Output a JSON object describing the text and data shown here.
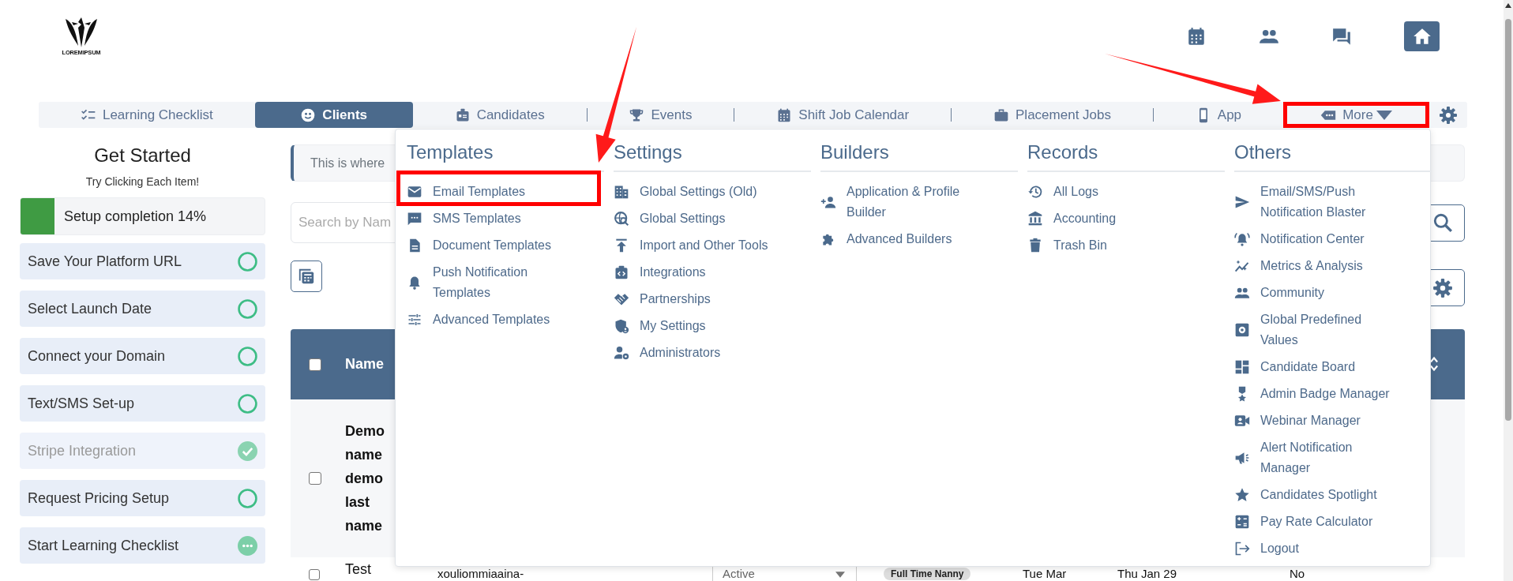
{
  "logo": {
    "text": "LOREMIPSUM"
  },
  "nav": {
    "tabs": [
      {
        "label": "Learning Checklist",
        "selected": false
      },
      {
        "label": "Clients",
        "selected": true
      },
      {
        "label": "Candidates",
        "selected": false
      },
      {
        "label": "Events",
        "selected": false
      },
      {
        "label": "Shift Job Calendar",
        "selected": false
      },
      {
        "label": "Placement Jobs",
        "selected": false
      },
      {
        "label": "App",
        "selected": false
      },
      {
        "label": "More",
        "selected": false,
        "kind": "dropdown",
        "annotated": true
      }
    ]
  },
  "sidebar": {
    "title": "Get Started",
    "subtitle": "Try Clicking Each Item!",
    "progress": {
      "label": "Setup completion 14%",
      "level": 0.14
    },
    "items": [
      {
        "label": "Save Your Platform URL",
        "kind": "todo"
      },
      {
        "label": "Select Launch Date",
        "kind": "todo"
      },
      {
        "label": "Connect your Domain",
        "kind": "todo"
      },
      {
        "label": "Text/SMS Set-up",
        "kind": "todo"
      },
      {
        "label": "Stripe Integration",
        "kind": "done"
      },
      {
        "label": "Request Pricing Setup",
        "kind": "todo"
      },
      {
        "label": "Start Learning Checklist",
        "kind": "started"
      }
    ]
  },
  "main": {
    "banner": "This is where",
    "search": {
      "placeholder": "Search by Nam"
    },
    "table": {
      "header": {
        "checked": false,
        "columns": [
          "Name"
        ]
      },
      "rows": [
        {
          "checked": false,
          "emphasized": true,
          "name": "Demo name demo last name"
        },
        {
          "checked": false,
          "emphasized": false,
          "name": "Test",
          "column_3": "xouliommiaaina-",
          "status": "Active",
          "tag": "Full Time Nanny",
          "column_6": "Tue Mar",
          "column_7": "Thu Jan 29",
          "column_8": "No"
        }
      ]
    }
  },
  "menu": {
    "columns": [
      {
        "title": "Templates",
        "items": [
          {
            "label": "Email Templates",
            "annotated": true
          },
          {
            "label": "SMS Templates",
            "annotated": false
          },
          {
            "label": "Document Templates",
            "annotated": false
          },
          {
            "label": "Push Notification Templates",
            "annotated": false
          },
          {
            "label": "Advanced Templates",
            "annotated": false
          }
        ]
      },
      {
        "title": "Settings",
        "items": [
          {
            "label": "Global Settings (Old)",
            "annotated": false
          },
          {
            "label": "Global Settings",
            "annotated": false
          },
          {
            "label": "Import and Other Tools",
            "annotated": false
          },
          {
            "label": "Integrations",
            "annotated": false
          },
          {
            "label": "Partnerships",
            "annotated": false
          },
          {
            "label": "My Settings",
            "annotated": false
          },
          {
            "label": "Administrators",
            "annotated": false
          }
        ]
      },
      {
        "title": "Builders",
        "items": [
          {
            "label": "Application & Profile Builder",
            "annotated": false
          },
          {
            "label": "Advanced Builders",
            "annotated": false
          }
        ]
      },
      {
        "title": "Records",
        "items": [
          {
            "label": "All Logs",
            "annotated": false
          },
          {
            "label": "Accounting",
            "annotated": false
          },
          {
            "label": "Trash Bin",
            "annotated": false
          }
        ]
      },
      {
        "title": "Others",
        "items": [
          {
            "label": "Email/SMS/Push Notification Blaster",
            "annotated": false
          },
          {
            "label": "Notification Center",
            "annotated": false
          },
          {
            "label": "Metrics & Analysis",
            "annotated": false
          },
          {
            "label": "Community",
            "annotated": false
          },
          {
            "label": "Global Predefined Values",
            "annotated": false
          },
          {
            "label": "Candidate Board",
            "annotated": false
          },
          {
            "label": "Admin Badge Manager",
            "annotated": false
          },
          {
            "label": "Webinar Manager",
            "annotated": false
          },
          {
            "label": "Alert Notification Manager",
            "annotated": false
          },
          {
            "label": "Candidates Spotlight",
            "annotated": false
          },
          {
            "label": "Pay Rate Calculator",
            "annotated": false
          },
          {
            "label": "Logout",
            "annotated": false
          }
        ]
      }
    ]
  }
}
